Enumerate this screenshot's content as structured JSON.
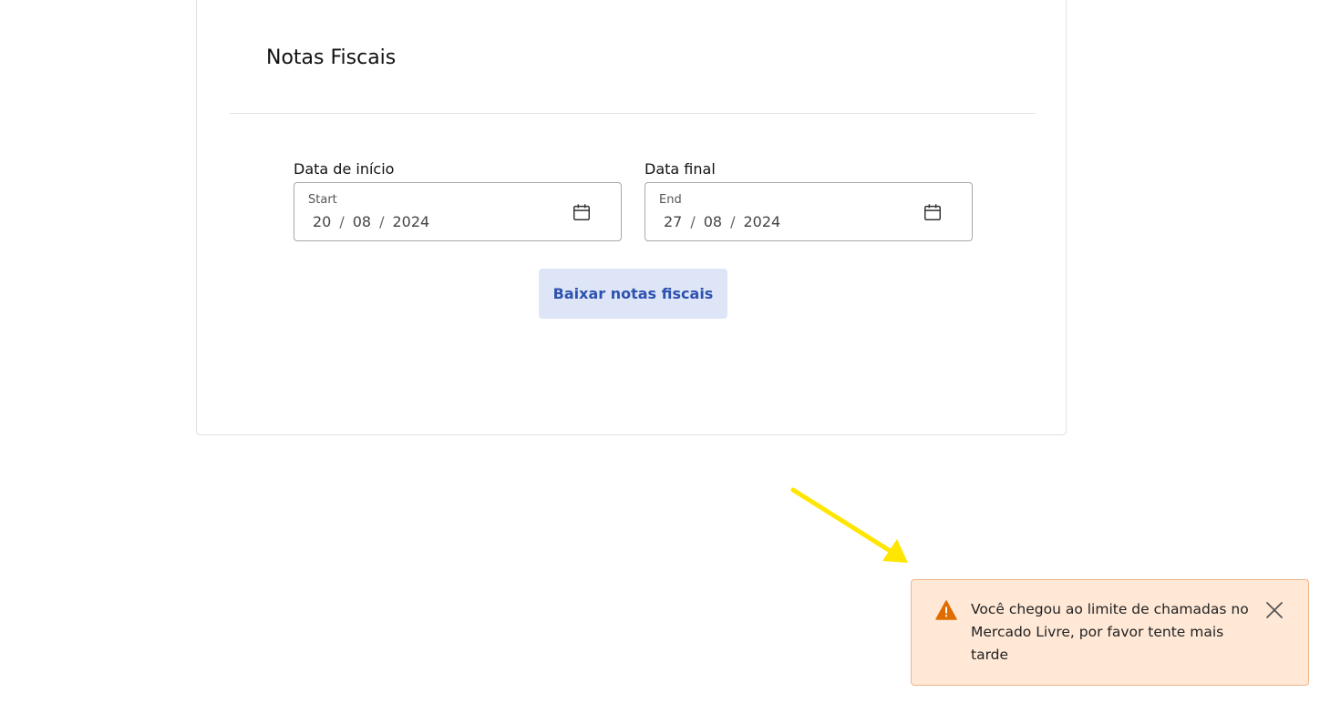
{
  "page": {
    "title": "Notas Fiscais"
  },
  "date_range": {
    "start": {
      "label": "Data de início",
      "hint": "Start",
      "day": "20",
      "month": "08",
      "year": "2024",
      "icon": "calendar-icon"
    },
    "end": {
      "label": "Data final",
      "hint": "End",
      "day": "27",
      "month": "08",
      "year": "2024",
      "icon": "calendar-icon"
    },
    "separator": "/"
  },
  "actions": {
    "download_label": "Baixar notas fiscais"
  },
  "toast": {
    "type": "warning",
    "message": "Você chegou ao limite de chamadas no Mercado Livre, por favor tente mais tarde",
    "icon": "warning-icon",
    "close_icon": "close-icon"
  },
  "annotation": {
    "type": "arrow",
    "color": "#ffe600"
  },
  "colors": {
    "button_bg": "#dde5f7",
    "button_text": "#2d52b0",
    "toast_bg": "#ffe8d6",
    "toast_border": "#f0b38a",
    "warning": "#e06c00"
  }
}
